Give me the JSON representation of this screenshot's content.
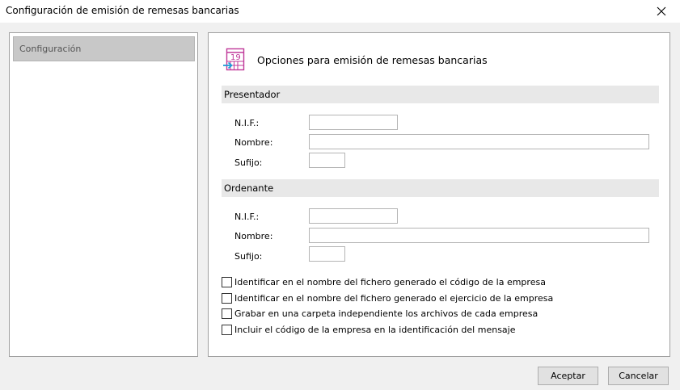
{
  "window": {
    "title": "Configuración de emisión de remesas bancarias"
  },
  "sidebar": {
    "items": [
      {
        "label": "Configuración",
        "selected": true
      }
    ]
  },
  "main": {
    "header_icon_text": "19",
    "header_title": "Opciones para emisión de remesas bancarias",
    "presentador": {
      "title": "Presentador",
      "nif_label": "N.I.F.:",
      "nif_value": "",
      "nombre_label": "Nombre:",
      "nombre_value": "",
      "sufijo_label": "Sufijo:",
      "sufijo_value": ""
    },
    "ordenante": {
      "title": "Ordenante",
      "nif_label": "N.I.F.:",
      "nif_value": "",
      "nombre_label": "Nombre:",
      "nombre_value": "",
      "sufijo_label": "Sufijo:",
      "sufijo_value": ""
    },
    "options": [
      {
        "label": "Identificar en el nombre del fichero generado el código de la empresa",
        "checked": false
      },
      {
        "label": "Identificar en el nombre del fichero generado el ejercicio de la empresa",
        "checked": false
      },
      {
        "label": "Grabar en una carpeta independiente los archivos de cada empresa",
        "checked": false
      },
      {
        "label": "Incluir el código de la empresa en la identificación del mensaje",
        "checked": false
      }
    ]
  },
  "footer": {
    "accept_label": "Aceptar",
    "cancel_label": "Cancelar"
  },
  "colors": {
    "icon_magenta": "#c0399a",
    "icon_arrow": "#1f9ad6",
    "section_bg": "#e8e8e8",
    "nav_selected_bg": "#c8c8c8"
  }
}
